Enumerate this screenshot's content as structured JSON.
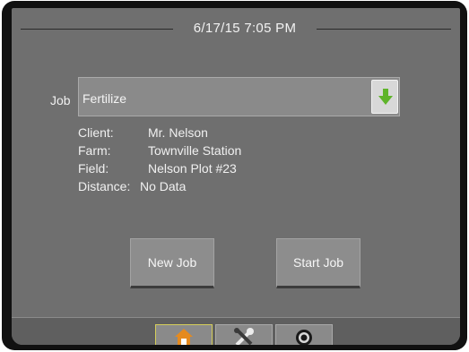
{
  "header": {
    "datetime": "6/17/15 7:05 PM"
  },
  "job": {
    "label": "Job",
    "value": "Fertilize",
    "dropdown_icon": "green-down-arrow-icon"
  },
  "details": [
    {
      "label": "Client:",
      "value": "Mr. Nelson"
    },
    {
      "label": "Farm:",
      "value": "Townville Station"
    },
    {
      "label": "Field:",
      "value": "Nelson Plot #23"
    },
    {
      "label": "Distance:",
      "value": "No Data"
    }
  ],
  "buttons": {
    "new_job": "New Job",
    "start_job": "Start Job"
  },
  "tabs": [
    {
      "name": "home",
      "icon": "home-icon",
      "active": true
    },
    {
      "name": "tools",
      "icon": "tools-icon",
      "active": false
    },
    {
      "name": "camera",
      "icon": "camera-icon",
      "active": false
    }
  ],
  "colors": {
    "screen_bg": "#6f6f6f",
    "arrow_green": "#5fb42a",
    "home_orange": "#e58a1f",
    "active_tab_border": "#d6cf5a"
  }
}
